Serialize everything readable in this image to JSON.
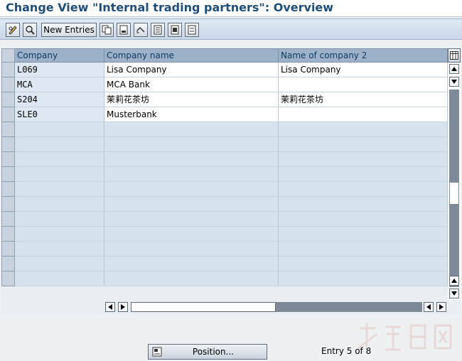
{
  "window": {
    "title": "Change View \"Internal trading partners\": Overview"
  },
  "toolbar": {
    "new_entries_label": "New Entries"
  },
  "table": {
    "columns": [
      {
        "label": "Company"
      },
      {
        "label": "Company name"
      },
      {
        "label": "Name of company 2"
      }
    ],
    "rows": [
      {
        "company": "L069",
        "company_name": "Lisa Company",
        "name2": "Lisa Company"
      },
      {
        "company": "MCA",
        "company_name": "MCA Bank",
        "name2": ""
      },
      {
        "company": "S204",
        "company_name": "茉莉花茶坊",
        "name2": "茉莉花茶坊"
      },
      {
        "company": "SLE0",
        "company_name": "Musterbank",
        "name2": ""
      }
    ],
    "empty_rows": 12
  },
  "footer": {
    "position_label": "Position...",
    "entry_info": "Entry 5 of 8"
  },
  "colors": {
    "title": "#1f4e79",
    "header": "#9db2c9",
    "key_cell": "#dde8f3",
    "empty_cell": "#d6e2ee",
    "toolbar": "#c9d8e8"
  }
}
